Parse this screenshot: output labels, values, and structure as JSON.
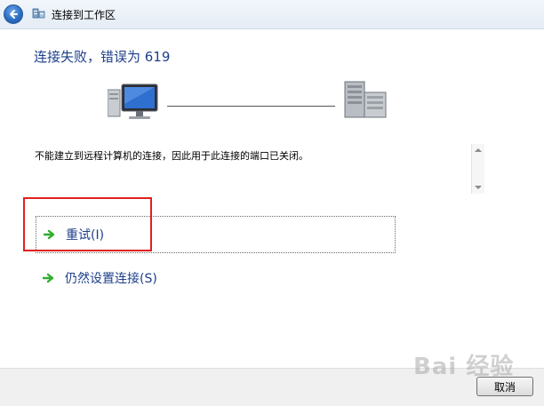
{
  "window": {
    "title": "连接到工作区"
  },
  "heading": "连接失败，错误为 619",
  "message": "不能建立到远程计算机的连接，因此用于此连接的端口已关闭。",
  "commands": {
    "retry_label": "重试(I)",
    "setup_label": "仍然设置连接(S)"
  },
  "footer": {
    "cancel_label": "取消"
  },
  "watermark": "Bai 经验",
  "icons": {
    "back": "back-arrow-icon",
    "title": "workplace-network-icon",
    "computer": "computer-icon",
    "server": "server-icon",
    "command_arrow": "green-arrow-icon"
  },
  "colors": {
    "heading": "#1e3f8a",
    "link": "#1e3f8a",
    "highlight": "#e02020",
    "arrow": "#2eae2e"
  }
}
